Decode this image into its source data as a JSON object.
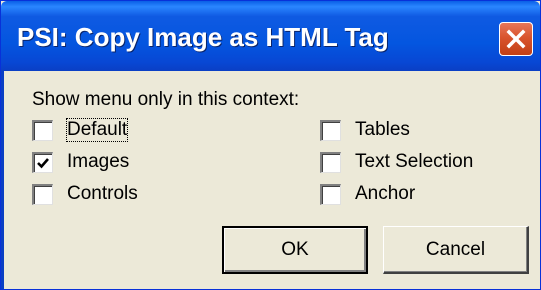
{
  "window": {
    "title": "PSI: Copy Image as HTML Tag",
    "close_icon": "close-x-icon"
  },
  "dialog": {
    "context_label": "Show menu only in this context:",
    "options": [
      {
        "label": "Default",
        "checked": false,
        "focused": true
      },
      {
        "label": "Images",
        "checked": true,
        "focused": false
      },
      {
        "label": "Controls",
        "checked": false,
        "focused": false
      },
      {
        "label": "Tables",
        "checked": false,
        "focused": false
      },
      {
        "label": "Text Selection",
        "checked": false,
        "focused": false
      },
      {
        "label": "Anchor",
        "checked": false,
        "focused": false
      }
    ],
    "ok_label": "OK",
    "cancel_label": "Cancel"
  },
  "colors": {
    "titlebar": "#0456e0",
    "close_button": "#d9542d",
    "dialog_background": "#ece9d8"
  }
}
